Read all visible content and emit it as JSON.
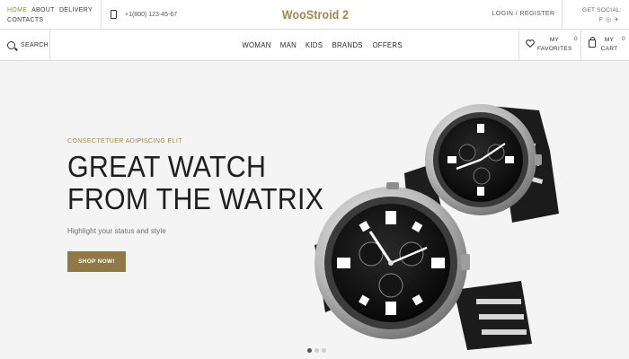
{
  "topbar": {
    "nav": [
      "Home",
      "About",
      "Delivery",
      "Contacts"
    ],
    "phone": "+1(800) 123-45-67",
    "logo": "WooStroid 2",
    "login": "Login",
    "separator": "/",
    "register": "Register",
    "social_label": "Get Social:",
    "social_icons": [
      "facebook-icon",
      "instagram-icon",
      "twitter-icon"
    ]
  },
  "navbar": {
    "search_label": "Search",
    "menu": [
      "Woman",
      "Man",
      "Kids",
      "Brands",
      "Offers"
    ],
    "favorites_label": "My Favorites",
    "favorites_count": "0",
    "cart_label": "My Cart",
    "cart_count": "0"
  },
  "hero": {
    "kicker": "Consectetuer adipiscing elit",
    "title_line1": "Great Watch",
    "title_line2": "from the Watrix",
    "subtitle": "Highlight your status and style",
    "button": "Shop now!",
    "slides": 3,
    "active_slide": 1
  },
  "colors": {
    "accent": "#a18650",
    "button": "#917945",
    "hero_bg": "#f4f4f4"
  }
}
